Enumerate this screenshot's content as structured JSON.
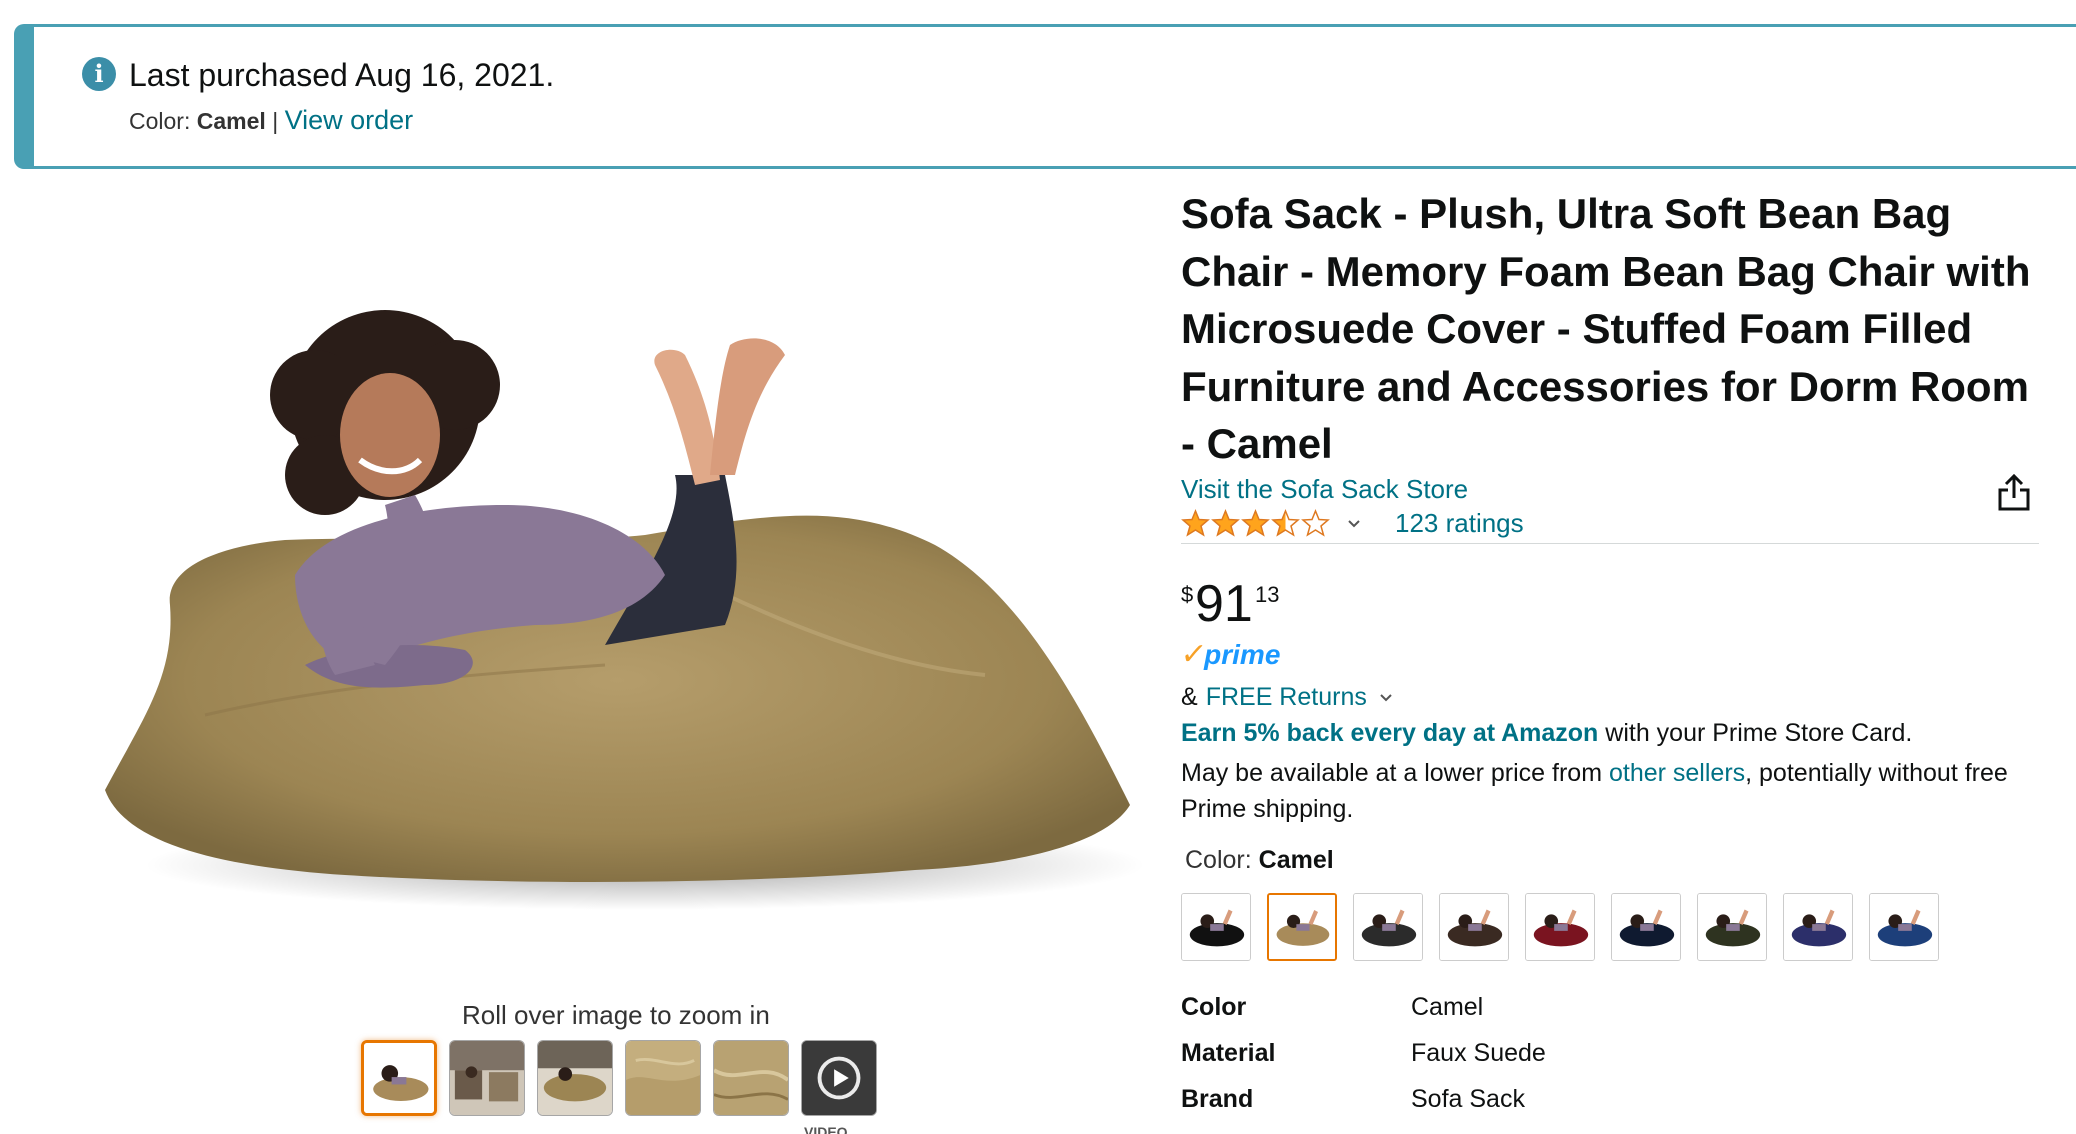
{
  "banner": {
    "title": "Last purchased Aug 16, 2021.",
    "color_label": "Color:",
    "color_value": "Camel",
    "separator": "|",
    "view_order": "View order"
  },
  "gallery": {
    "zoom_hint": "Roll over image to zoom in",
    "video_label": "VIDEO"
  },
  "product": {
    "title": "Sofa Sack - Plush, Ultra Soft Bean Bag Chair - Memory Foam Bean Bag Chair with Microsuede Cover - Stuffed Foam Filled Furniture and Accessories for Dorm Room - Camel",
    "store_link": "Visit the Sofa Sack Store",
    "rating": 3.5,
    "ratings_count": "123 ratings",
    "price_symbol": "$",
    "price_whole": "91",
    "price_fraction": "13",
    "prime_label": "prime",
    "returns_prefix": "&",
    "returns_link": "FREE Returns",
    "earn_link": "Earn 5% back every day at Amazon",
    "earn_text": " with your Prime Store Card.",
    "lower_text_1": "May be available at a lower price from ",
    "lower_link": "other sellers",
    "lower_text_2": ", potentially without free Prime shipping.",
    "color_label": "Color: ",
    "color_value": "Camel",
    "swatches": [
      "#111111",
      "#a88b5a",
      "#2b2b2b",
      "#3a2a22",
      "#7a1420",
      "#0f1a30",
      "#2e3320",
      "#2c2f6a",
      "#1d3f7a"
    ],
    "specs": [
      {
        "key": "Color",
        "value": "Camel"
      },
      {
        "key": "Material",
        "value": "Faux Suede"
      },
      {
        "key": "Brand",
        "value": "Sofa Sack"
      }
    ]
  },
  "colors": {
    "link": "#007185",
    "banner_accent": "#49a0b4",
    "star": "#ffa41c",
    "selected_border": "#e77600"
  }
}
